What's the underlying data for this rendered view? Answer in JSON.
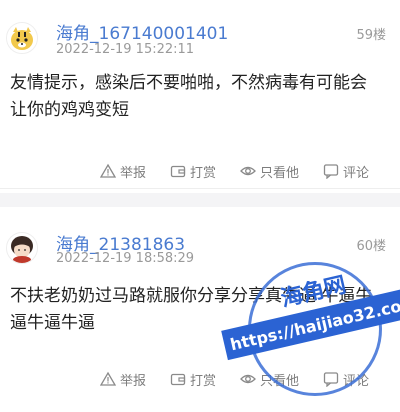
{
  "posts": [
    {
      "username": "海角_167140001401",
      "datetime": "2022-12-19 15:22:11",
      "floor": "59楼",
      "content": "友情提示，感染后不要啪啪，不然病毒有可能会让你的鸡鸡变短",
      "actions": {
        "report": "举报",
        "tip": "打赏",
        "only_this": "只看他",
        "comment": "评论"
      }
    },
    {
      "username": "海角_21381863",
      "datetime": "2022-12-19 18:58:29",
      "floor": "60楼",
      "content": "不扶老奶奶过马路就服你分享分享真牛逼 牛逼牛逼牛逼牛逼",
      "actions": {
        "report": "举报",
        "tip": "打赏",
        "only_this": "只看他",
        "comment": "评论"
      }
    }
  ],
  "watermark": {
    "name": "海角网",
    "url": "https://haijiao32.com"
  },
  "icons": {
    "report": "warning-triangle-icon",
    "tip": "wallet-icon",
    "only_this": "eye-icon",
    "comment": "comment-icon"
  },
  "colors": {
    "username": "#4a7bd0",
    "meta": "#9a9a9a",
    "watermark": "#2b63d3"
  }
}
